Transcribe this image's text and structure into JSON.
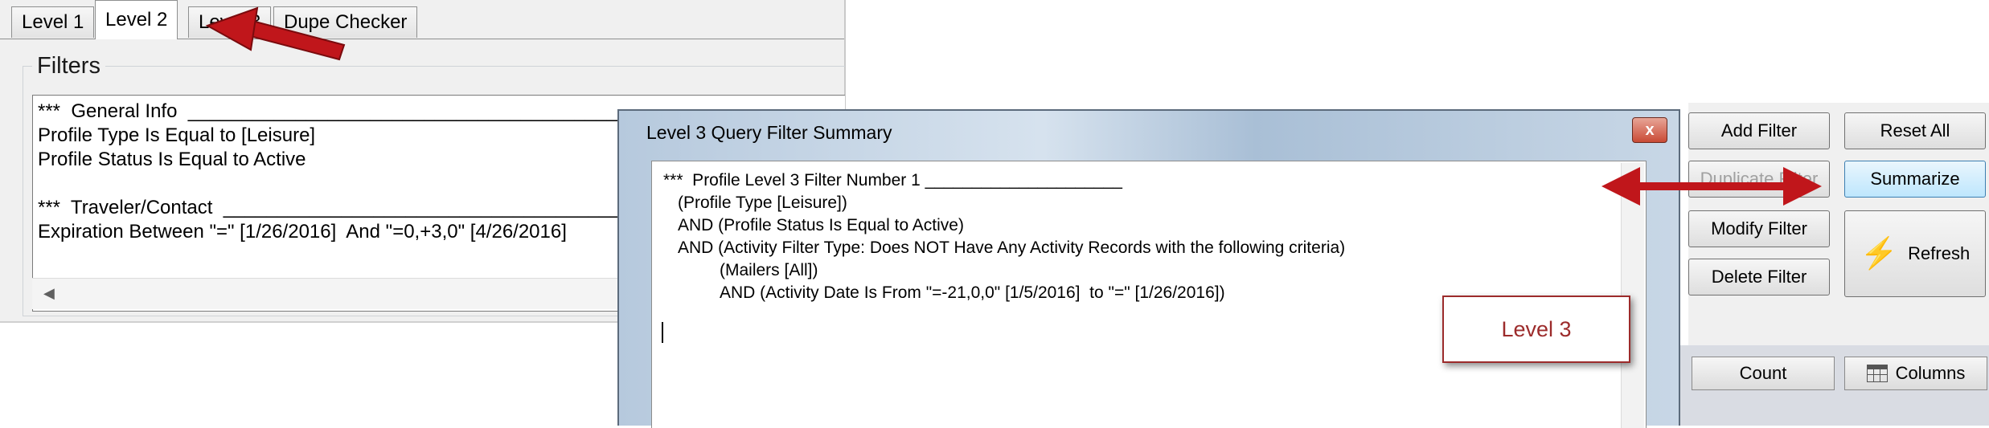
{
  "tabs": [
    "Level 1",
    "Level 2",
    "Level 3",
    "Dupe Checker"
  ],
  "active_tab": "Level 2",
  "filters_group": {
    "label": "Filters",
    "lines": [
      "***  General Info  ______________________________________________________",
      "Profile Type Is Equal to [Leisure]",
      "Profile Status Is Equal to Active",
      "",
      "***  Traveler/Contact  ___________________________________________________",
      "Expiration Between \"=\" [1/26/2016]  And \"=0,+3,0\" [4/26/2016]"
    ]
  },
  "buttons": {
    "add_filter": "Add Filter",
    "reset_all": "Reset All",
    "duplicate_filter": "Duplicate Filter",
    "summarize": "Summarize",
    "modify_filter": "Modify Filter",
    "refresh": "Refresh",
    "delete_filter": "Delete Filter",
    "count": "Count",
    "columns": "Columns"
  },
  "dialog": {
    "title": "Level 3 Query Filter Summary",
    "close_glyph": "x",
    "lines": [
      "***  Profile Level 3 Filter Number 1 _____________________",
      "(Profile Type [Leisure])",
      "AND (Profile Status Is Equal to Active)",
      "AND (Activity Filter Type: Does NOT Have Any Activity Records with the following criteria)",
      "(Mailers [All])",
      "AND (Activity Date Is From \"=-21,0,0\" [1/5/2016]  to \"=\" [1/26/2016])"
    ]
  },
  "annotation": {
    "callout_text": "Level 3",
    "color": "#c0161b"
  },
  "icons": [
    "left-scroll-arrow-icon",
    "refresh-bolt-icon",
    "columns-grid-icon",
    "close-icon",
    "red-arrow-icon",
    "double-headed-arrow-icon"
  ]
}
